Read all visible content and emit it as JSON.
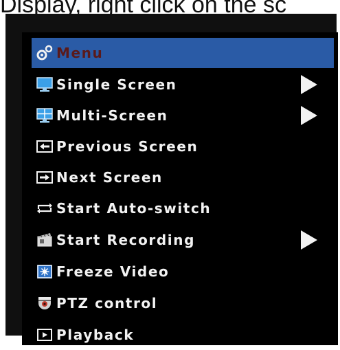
{
  "caption": {
    "text": "Display, right click on the sc"
  },
  "menu": {
    "items": [
      {
        "label": "Menu",
        "icon": "gears-icon",
        "highlighted": true,
        "submenu": false
      },
      {
        "label": "Single Screen",
        "icon": "monitor-icon",
        "highlighted": false,
        "submenu": true
      },
      {
        "label": "Multi-Screen",
        "icon": "multi-screen-icon",
        "highlighted": false,
        "submenu": true
      },
      {
        "label": "Previous Screen",
        "icon": "previous-screen-icon",
        "highlighted": false,
        "submenu": false
      },
      {
        "label": "Next Screen",
        "icon": "next-screen-icon",
        "highlighted": false,
        "submenu": false
      },
      {
        "label": "Start Auto-switch",
        "icon": "auto-switch-icon",
        "highlighted": false,
        "submenu": false
      },
      {
        "label": "Start Recording",
        "icon": "recording-icon",
        "highlighted": false,
        "submenu": true
      },
      {
        "label": "Freeze Video",
        "icon": "freeze-icon",
        "highlighted": false,
        "submenu": false
      },
      {
        "label": "PTZ control",
        "icon": "ptz-camera-icon",
        "highlighted": false,
        "submenu": false
      },
      {
        "label": "Playback",
        "icon": "playback-icon",
        "highlighted": false,
        "submenu": false
      }
    ]
  },
  "colors": {
    "highlight": "#2a5ba6",
    "menu_background": "#000000",
    "text": "#f2f2f2",
    "highlight_text": "#5a1a1a"
  }
}
